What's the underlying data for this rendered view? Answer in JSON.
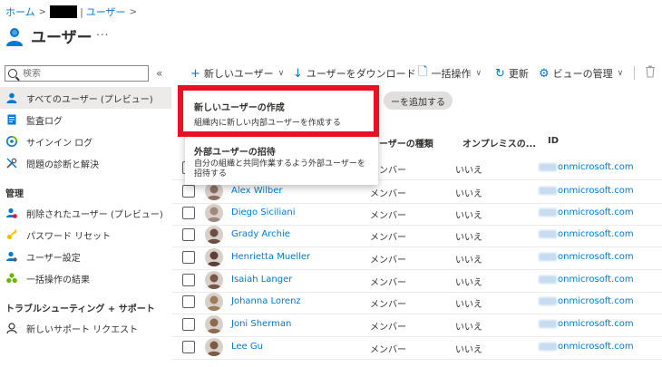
{
  "breadcrumb": {
    "home": "ホーム",
    "section": "ユーザー"
  },
  "page": {
    "title": "ユーザー",
    "more": "..."
  },
  "sidebar": {
    "search_placeholder": "検索",
    "collapse": "«",
    "items": [
      {
        "label": "すべてのユーザー (プレビュー)",
        "icon": "user-icon",
        "active": true
      },
      {
        "label": "監査ログ",
        "icon": "audit-log-icon"
      },
      {
        "label": "サインイン ログ",
        "icon": "signin-log-icon"
      },
      {
        "label": "問題の診断と解決",
        "icon": "wrench-icon"
      }
    ],
    "manage_header": "管理",
    "manage_items": [
      {
        "label": "削除されたユーザー (プレビュー)",
        "icon": "deleted-user-icon"
      },
      {
        "label": "パスワード リセット",
        "icon": "key-icon"
      },
      {
        "label": "ユーザー設定",
        "icon": "user-settings-icon"
      },
      {
        "label": "一括操作の結果",
        "icon": "bulk-results-icon"
      }
    ],
    "support_header": "トラブルシューティング + サポート",
    "support_items": [
      {
        "label": "新しいサポート リクエスト",
        "icon": "support-icon"
      }
    ]
  },
  "toolbar": {
    "new_user": "新しいユーザー",
    "download": "ユーザーをダウンロード",
    "bulk": "一括操作",
    "refresh": "更新",
    "view_manage": "ビューの管理"
  },
  "filter": {
    "add_filter": "ーを追加する"
  },
  "dropdown": {
    "create_title": "新しいユーザーの作成",
    "create_desc": "組織内に新しい内部ユーザーを作成する",
    "invite_title": "外部ユーザーの招待",
    "invite_desc_1": "自分の組織と共同作業するよう外部ユーザーを",
    "invite_desc_2": "招待する"
  },
  "table": {
    "headers": {
      "type": "ーザーの種類",
      "onprem": "オンプレミスの...",
      "id": "ID"
    },
    "rows": [
      {
        "name": "",
        "type": "メンバー",
        "onprem": "いいえ",
        "id": "onmicrosoft.com",
        "avatar": "#b0b0b0"
      },
      {
        "name": "Alex Wilber",
        "type": "メンバー",
        "onprem": "いいえ",
        "id": "onmicrosoft.com",
        "avatar": "#8d6e63"
      },
      {
        "name": "Diego Siciliani",
        "type": "メンバー",
        "onprem": "いいえ",
        "id": "onmicrosoft.com",
        "avatar": "#a1887f"
      },
      {
        "name": "Grady Archie",
        "type": "メンバー",
        "onprem": "いいえ",
        "id": "onmicrosoft.com",
        "avatar": "#6d4c41"
      },
      {
        "name": "Henrietta Mueller",
        "type": "メンバー",
        "onprem": "いいえ",
        "id": "onmicrosoft.com",
        "avatar": "#5d4037"
      },
      {
        "name": "Isaiah Langer",
        "type": "メンバー",
        "onprem": "いいえ",
        "id": "onmicrosoft.com",
        "avatar": "#795548"
      },
      {
        "name": "Johanna Lorenz",
        "type": "メンバー",
        "onprem": "いいえ",
        "id": "onmicrosoft.com",
        "avatar": "#9e7b5a"
      },
      {
        "name": "Joni Sherman",
        "type": "メンバー",
        "onprem": "いいえ",
        "id": "onmicrosoft.com",
        "avatar": "#8a6a52"
      },
      {
        "name": "Lee Gu",
        "type": "メンバー",
        "onprem": "いいえ",
        "id": "onmicrosoft.com",
        "avatar": "#7a5c44"
      }
    ]
  }
}
